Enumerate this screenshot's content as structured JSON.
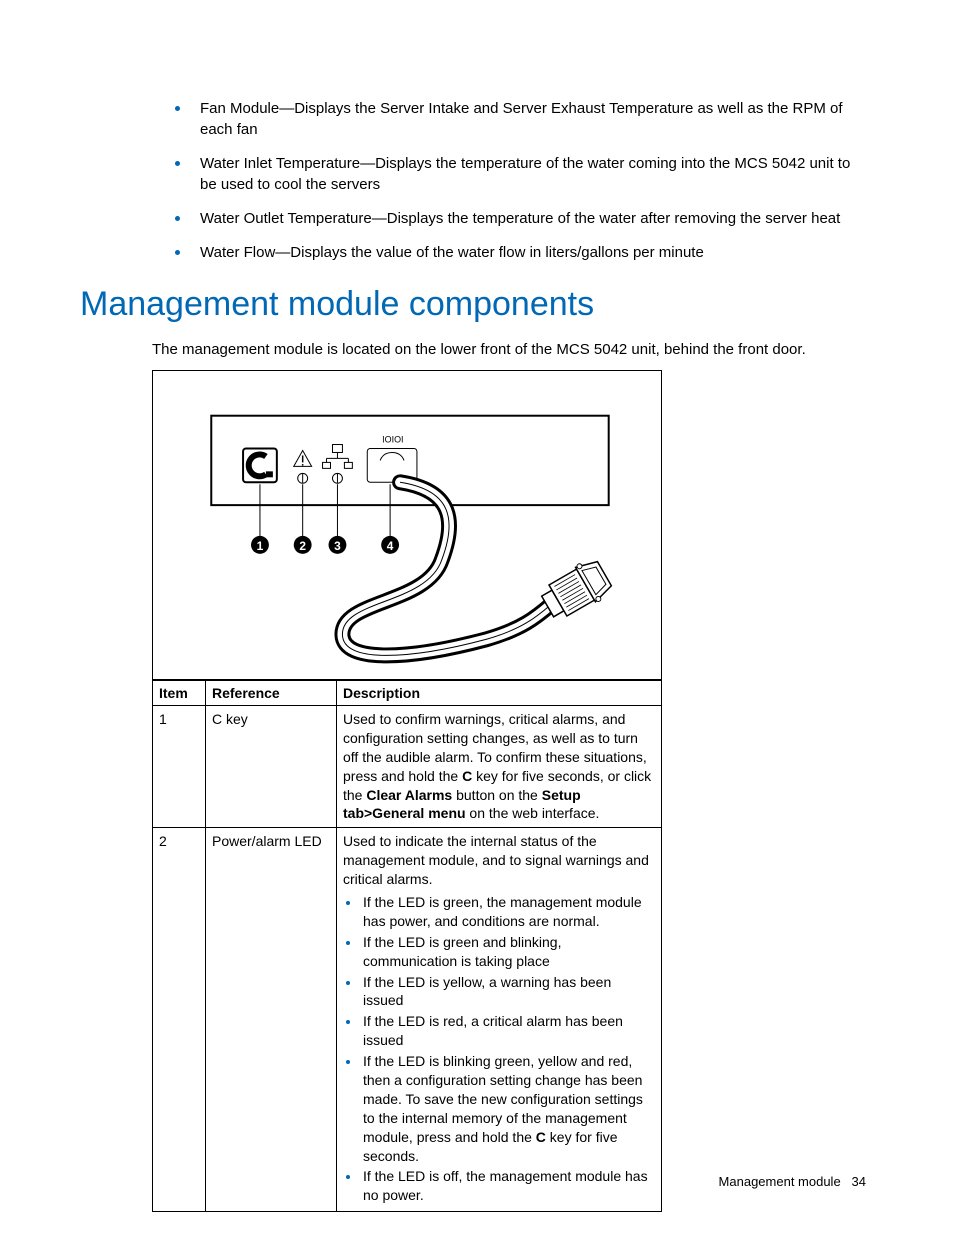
{
  "topBullets": [
    "Fan Module—Displays the Server Intake and Server Exhaust Temperature as well as the RPM of each fan",
    "Water Inlet Temperature—Displays the temperature of the water coming into the MCS 5042 unit to be used to cool the servers",
    "Water Outlet Temperature—Displays the temperature of the water after removing the server heat",
    "Water Flow—Displays the value of the water flow in liters/gallons per minute"
  ],
  "heading": "Management module components",
  "intro": "The management module is located on the lower front of the MCS 5042 unit, behind the front door.",
  "table": {
    "headers": {
      "item": "Item",
      "reference": "Reference",
      "description": "Description"
    },
    "rows": [
      {
        "item": "1",
        "reference": "C key",
        "desc_pre": "Used to confirm warnings, critical alarms, and configuration setting changes, as well as to turn off the audible alarm. To confirm these situations, press and hold the ",
        "bold1": "C",
        "desc_mid1": " key for five seconds, or click the ",
        "bold2": "Clear Alarms",
        "desc_mid2": " button on the ",
        "bold3": "Setup tab>General menu",
        "desc_post": " on the web interface."
      },
      {
        "item": "2",
        "reference": "Power/alarm LED",
        "desc_intro": "Used to indicate the internal status of the management module, and to signal warnings and critical alarms.",
        "bullets": [
          "If the LED is green, the management module has power, and conditions are normal.",
          "If the LED is green and blinking, communication is taking place",
          "If the LED is yellow, a warning has been issued",
          "If the LED is red, a critical alarm has been issued"
        ],
        "bullet5_pre": "If the LED is blinking green, yellow and red, then a configuration setting change has been made. To save the new configuration settings to the internal memory of the management module, press and hold the ",
        "bullet5_bold": "C",
        "bullet5_post": " key for five seconds.",
        "bullet6": "If the LED is off, the management module has no power."
      }
    ]
  },
  "footer": {
    "label": "Management module",
    "page": "34"
  }
}
